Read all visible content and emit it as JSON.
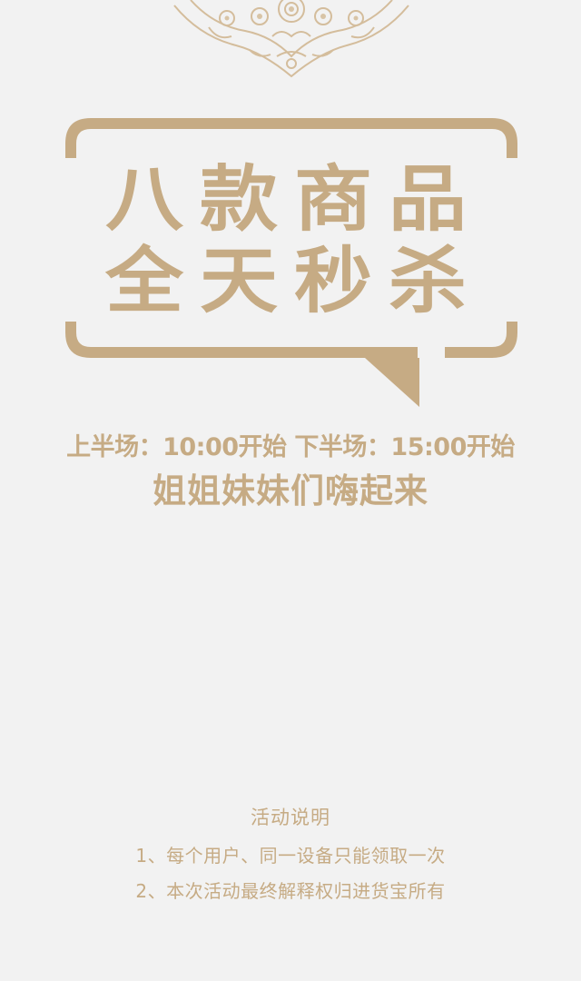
{
  "headline": {
    "line1": "八款商品",
    "line2": "全天秒杀"
  },
  "schedule": "上半场：10:00开始 下半场：15:00开始",
  "slogan": "姐姐妹妹们嗨起来",
  "rules": {
    "title": "活动说明",
    "items": [
      "1、每个用户、同一设备只能领取一次",
      "2、本次活动最终解释权归进货宝所有"
    ]
  },
  "colors": {
    "accent": "#c6ab84",
    "background": "#f2f2f2"
  }
}
